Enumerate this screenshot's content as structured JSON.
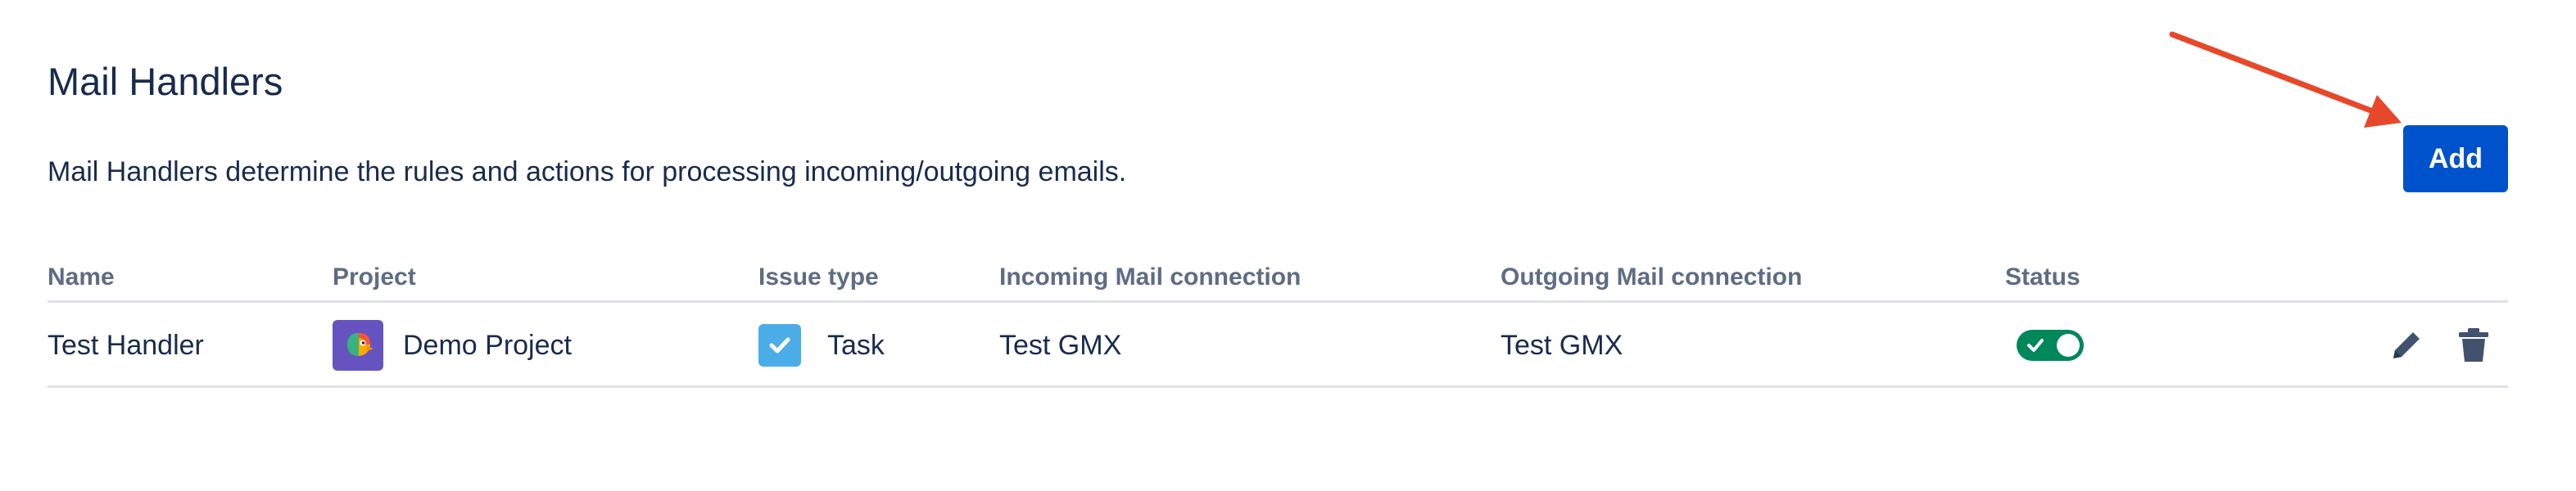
{
  "page": {
    "title": "Mail Handlers",
    "description": "Mail Handlers determine the rules and actions for processing incoming/outgoing emails.",
    "add_label": "Add"
  },
  "colors": {
    "primary": "#0052cc",
    "arrow": "#e8482a",
    "status_on": "#00875a",
    "project_avatar": "#6554c0",
    "task_icon": "#4bade8"
  },
  "table": {
    "headers": {
      "name": "Name",
      "project": "Project",
      "issue_type": "Issue type",
      "incoming": "Incoming Mail connection",
      "outgoing": "Outgoing Mail connection",
      "status": "Status"
    },
    "rows": [
      {
        "name": "Test Handler",
        "project": "Demo Project",
        "project_icon": "parrot-avatar-icon",
        "issue_type": "Task",
        "issue_icon": "task-checkbox-icon",
        "incoming": "Test GMX",
        "outgoing": "Test GMX",
        "status_enabled": true,
        "actions": [
          "edit-pencil-icon",
          "delete-trash-icon"
        ]
      }
    ]
  }
}
